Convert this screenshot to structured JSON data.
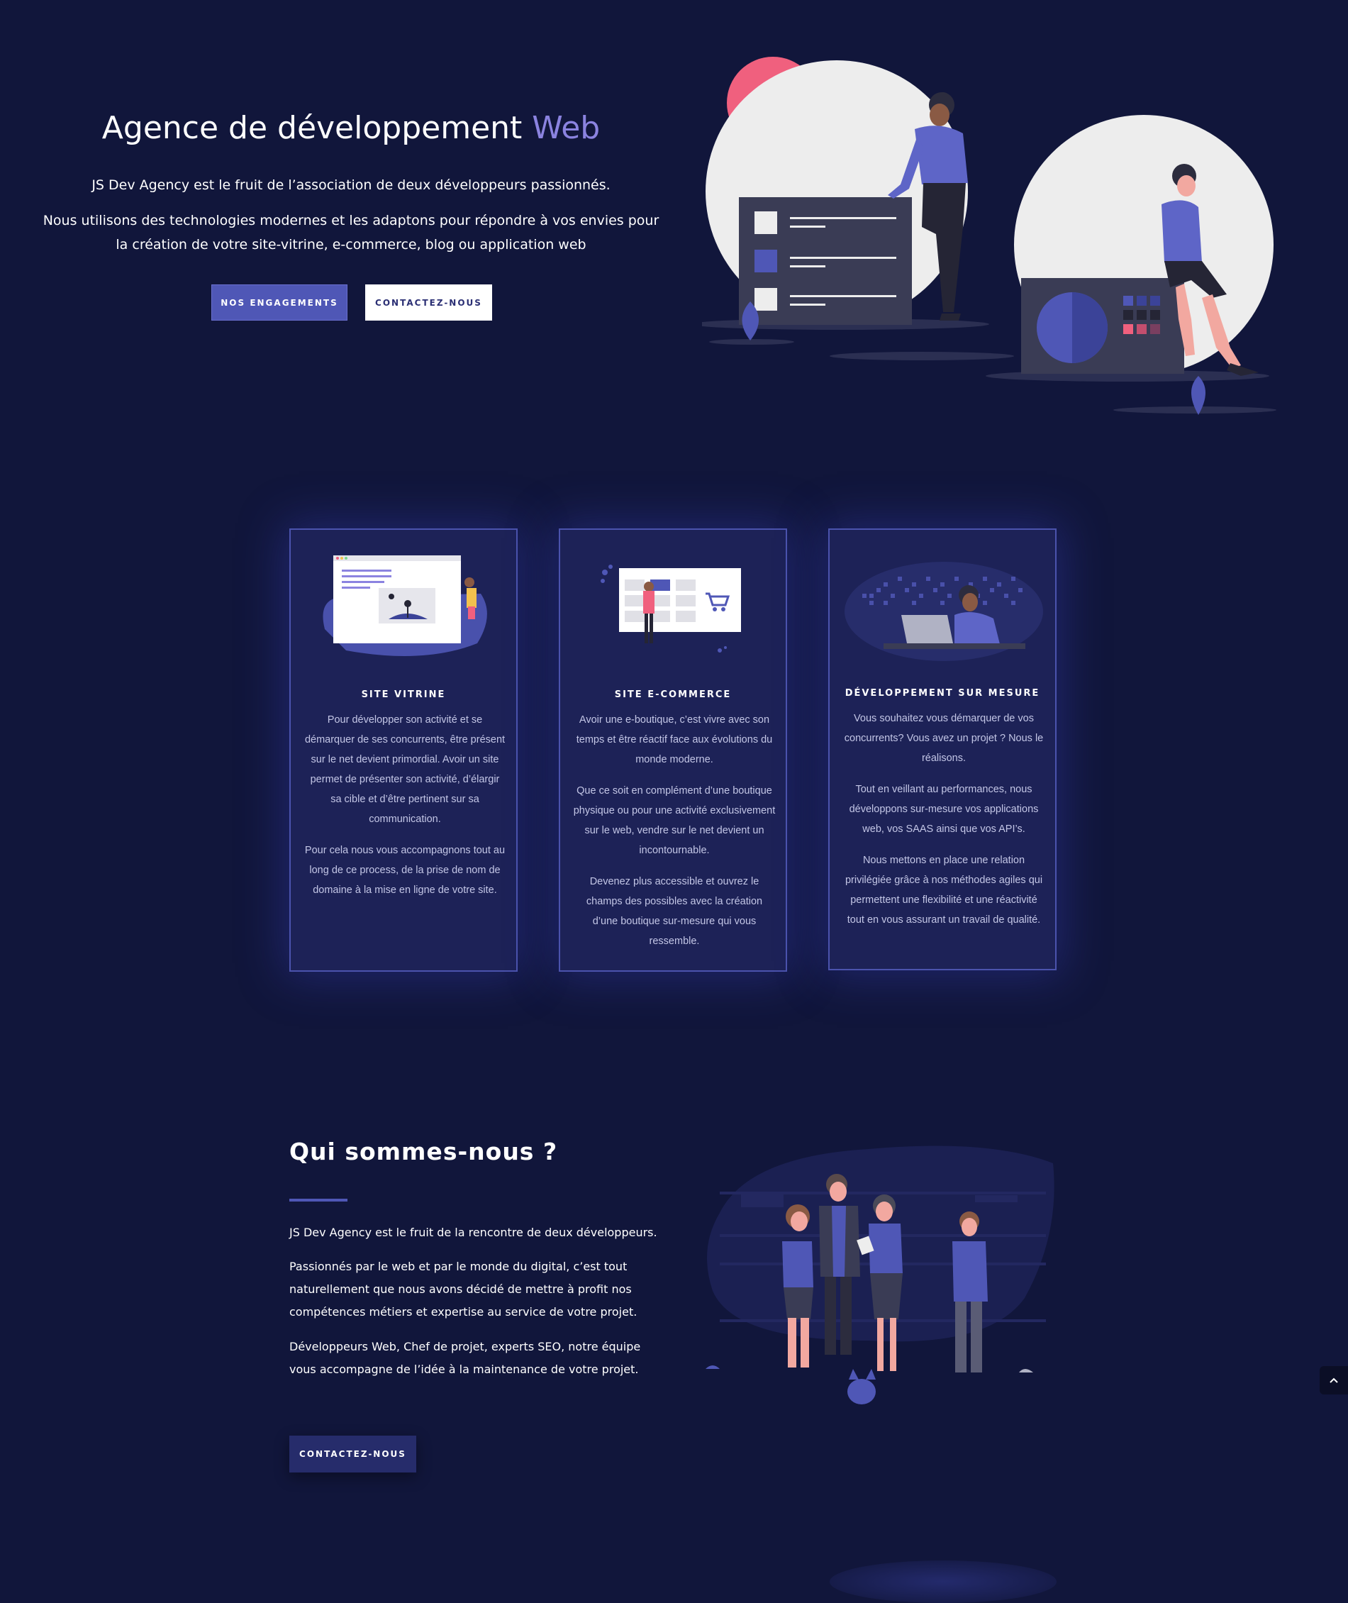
{
  "hero": {
    "title_main": "Agence de développement ",
    "title_accent": "Web",
    "subtitle_1": "JS Dev Agency est le fruit de l’association de deux développeurs passionnés.",
    "subtitle_2": "Nous utilisons des technologies modernes et les adaptons pour répondre à vos envies pour la création de votre site-vitrine, e-commerce, blog ou application web",
    "btn_primary": "NOS ENGAGEMENTS",
    "btn_secondary": "CONTACTEZ-NOUS"
  },
  "services": [
    {
      "title": "SITE VITRINE",
      "paragraphs": [
        "Pour développer son activité et se démarquer de ses concurrents, être présent sur le net devient primordial. Avoir un site permet de présenter son activité, d’élargir sa cible et d’être pertinent sur sa communication.",
        "Pour cela nous vous accompagnons tout au long de ce process, de la prise de nom de domaine à la mise en ligne de votre site."
      ]
    },
    {
      "title": "SITE E-COMMERCE",
      "paragraphs": [
        "Avoir une e-boutique, c’est vivre avec son temps et être réactif face aux évolutions du monde moderne.",
        "Que ce soit en complément d’une boutique physique ou pour une activité exclusivement sur le web, vendre sur le net devient un incontournable.",
        "Devenez plus accessible et ouvrez le champs des possibles  avec la création d’une boutique sur-mesure qui vous ressemble."
      ]
    },
    {
      "title": "DÉVELOPPEMENT SUR MESURE",
      "paragraphs": [
        "Vous souhaitez vous démarquer de vos concurrents? Vous avez un projet ? Nous le réalisons.",
        "Tout en veillant au performances, nous développons sur-mesure vos applications web,  vos SAAS ainsi que vos API’s.",
        "Nous mettons en place une relation privilégiée grâce à nos méthodes agiles qui permettent une flexibilité et une réactivité tout en vous assurant un travail de qualité."
      ]
    }
  ],
  "about": {
    "title": "Qui sommes-nous ?",
    "paragraph_1": "JS Dev Agency est le fruit de la rencontre de deux développeurs.",
    "paragraph_2": "Passionnés par le web et par le monde du digital, c’est tout naturellement que nous avons décidé de mettre à profit nos compétences métiers et expertise au service de votre projet.",
    "paragraph_3": "Développeurs Web, Chef de projet, experts SEO, notre équipe vous accompagne de l’idée à la maintenance de votre projet.",
    "button": "CONTACTEZ-NOUS"
  },
  "colors": {
    "background": "#11163b",
    "accent": "#4f57b6",
    "accent_text": "#8b83e0",
    "card_bg": "#1d2257",
    "pink": "#f0607e"
  },
  "icons": {
    "scroll_top": "chevron-up-icon"
  }
}
